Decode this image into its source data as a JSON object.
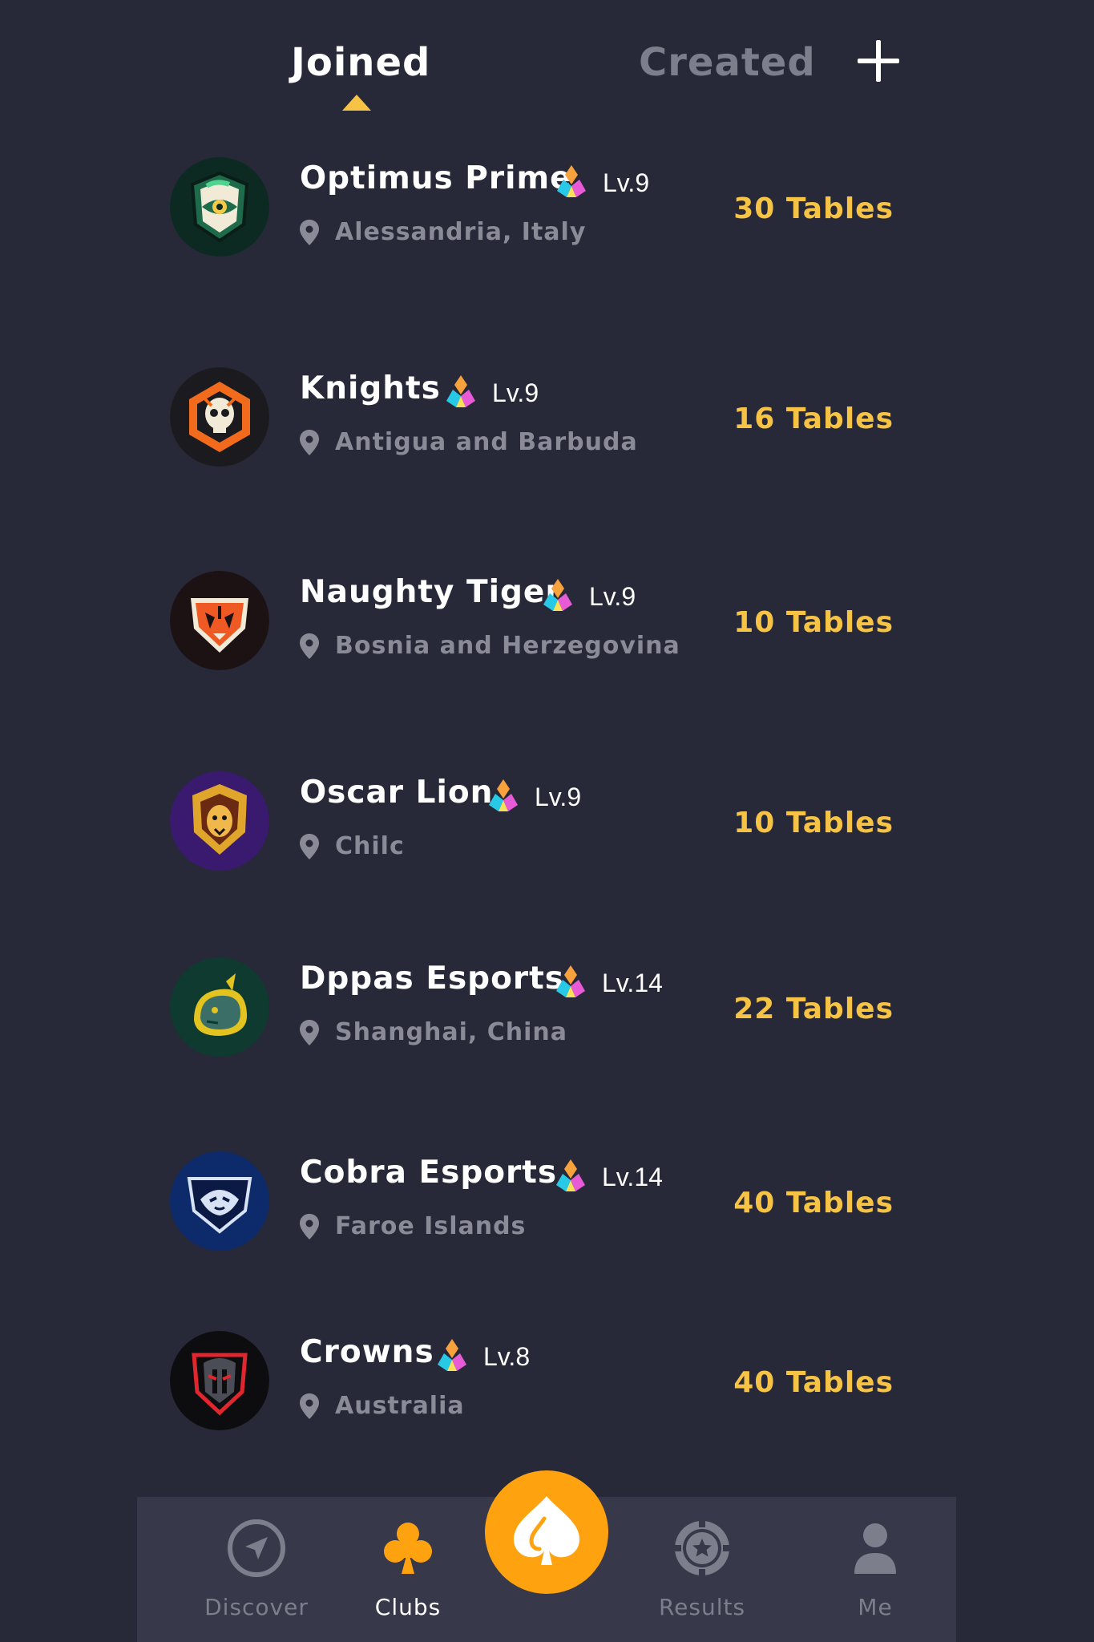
{
  "colors": {
    "background": "#272838",
    "nav_background": "#373849",
    "accent": "#f6c344",
    "play_button": "#ffa210",
    "muted_text": "#8a8b97"
  },
  "tabs": [
    {
      "label": "Joined",
      "active": true
    },
    {
      "label": "Created",
      "active": false
    }
  ],
  "add_button": {
    "icon": "plus-icon"
  },
  "clubs": [
    {
      "name": "Optimus Prime",
      "level": "Lv.9",
      "location": "Alessandria, Italy",
      "tables": "30 Tables",
      "logo": "green-eye-shield-logo"
    },
    {
      "name": "Knights",
      "level": "Lv.9",
      "location": "Antigua and Barbuda",
      "tables": "16 Tables",
      "logo": "orange-skull-logo"
    },
    {
      "name": "Naughty Tiger",
      "level": "Lv.9",
      "location": "Bosnia and Herzegovina",
      "tables": "10 Tables",
      "logo": "orange-tiger-logo"
    },
    {
      "name": "Oscar Lion",
      "level": "Lv.9",
      "location": "Chilc",
      "tables": "10 Tables",
      "logo": "purple-lion-logo"
    },
    {
      "name": "Dppas Esports",
      "level": "Lv.14",
      "location": "Shanghai, China",
      "tables": "22 Tables",
      "logo": "green-rhino-logo"
    },
    {
      "name": "Cobra Esports",
      "level": "Lv.14",
      "location": "Faroe Islands",
      "tables": "40 Tables",
      "logo": "blue-cobra-logo"
    },
    {
      "name": "Crowns",
      "level": "Lv.8",
      "location": "Australia",
      "tables": "40 Tables",
      "logo": "red-spartan-logo"
    }
  ],
  "bottom_nav": [
    {
      "label": "Discover",
      "icon": "compass-icon",
      "active": false
    },
    {
      "label": "Clubs",
      "icon": "club-suit-icon",
      "active": true
    },
    {
      "label": "Results",
      "icon": "poker-chip-icon",
      "active": false
    },
    {
      "label": "Me",
      "icon": "user-icon",
      "active": false
    }
  ],
  "play_button": {
    "icon": "spade-icon"
  }
}
